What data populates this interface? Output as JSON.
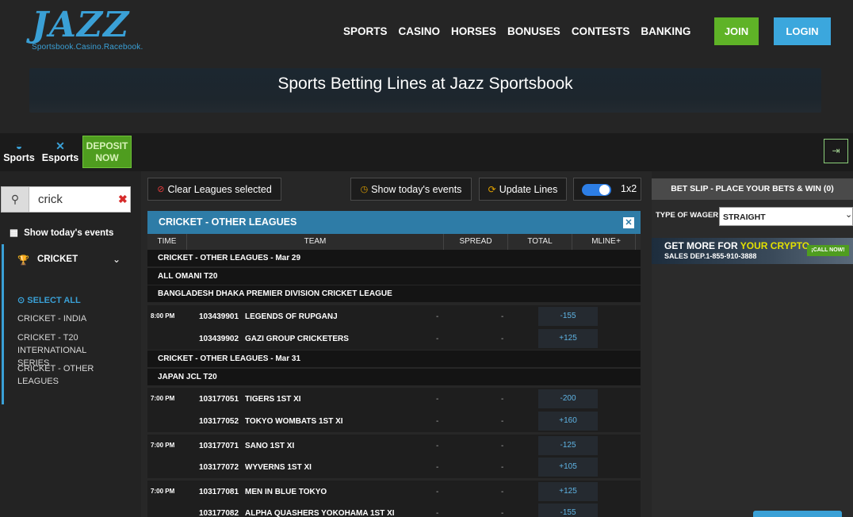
{
  "brand": {
    "logo": "JAZZ",
    "tagline": "Sportsbook.Casino.Racebook."
  },
  "nav": [
    "SPORTS",
    "CASINO",
    "HORSES",
    "BONUSES",
    "CONTESTS",
    "BANKING"
  ],
  "auth": {
    "join": "JOIN",
    "login": "LOGIN"
  },
  "hero_title": "Sports Betting Lines at Jazz Sportsbook",
  "strip": {
    "sports": "Sports",
    "esports": "Esports",
    "deposit": "DEPOSIT NOW"
  },
  "search": {
    "value": "crick",
    "placeholder": ""
  },
  "sidebar": {
    "today": "Show today's events",
    "sport": "CRICKET",
    "select_all": "SELECT ALL",
    "leagues": [
      "CRICKET - INDIA",
      "CRICKET - T20 INTERNATIONAL SERIES",
      "CRICKET - OTHER LEAGUES"
    ]
  },
  "tools": {
    "clear": "Clear Leagues selected",
    "today": "Show today's events",
    "update": "Update Lines",
    "toggle_label": "1x2"
  },
  "panel": {
    "title": "CRICKET - OTHER LEAGUES",
    "columns": [
      "TIME",
      "TEAM",
      "SPREAD",
      "TOTAL",
      "MLINE",
      "+"
    ]
  },
  "groups": [
    "CRICKET - OTHER LEAGUES - Mar 29",
    "ALL OMANI T20",
    "BANGLADESH DHAKA PREMIER DIVISION CRICKET LEAGUE",
    "CRICKET - OTHER LEAGUES - Mar 31",
    "JAPAN JCL T20"
  ],
  "events": [
    {
      "time": "8:00 PM",
      "num": "103439901",
      "team": "LEGENDS OF RUPGANJ",
      "spread": "-",
      "total": "-",
      "mline": "-155"
    },
    {
      "time": "",
      "num": "103439902",
      "team": "GAZI GROUP CRICKETERS",
      "spread": "-",
      "total": "-",
      "mline": "+125"
    },
    {
      "time": "7:00 PM",
      "num": "103177051",
      "team": "TIGERS 1ST XI",
      "spread": "-",
      "total": "-",
      "mline": "-200"
    },
    {
      "time": "",
      "num": "103177052",
      "team": "TOKYO WOMBATS 1ST XI",
      "spread": "-",
      "total": "-",
      "mline": "+160"
    },
    {
      "time": "7:00 PM",
      "num": "103177071",
      "team": "SANO 1ST XI",
      "spread": "-",
      "total": "-",
      "mline": "-125"
    },
    {
      "time": "",
      "num": "103177072",
      "team": "WYVERNS 1ST XI",
      "spread": "-",
      "total": "-",
      "mline": "+105"
    },
    {
      "time": "7:00 PM",
      "num": "103177081",
      "team": "MEN IN BLUE TOKYO",
      "spread": "-",
      "total": "-",
      "mline": "+125"
    },
    {
      "time": "",
      "num": "103177082",
      "team": "ALPHA QUASHERS YOKOHAMA 1ST XI",
      "spread": "-",
      "total": "-",
      "mline": "-155"
    }
  ],
  "betslip": {
    "header": "BET SLIP - PLACE YOUR BETS & WIN (0)",
    "wager_label": "TYPE OF WAGER",
    "wager_value": "STRAIGHT"
  },
  "promo": {
    "line1a": "GET MORE FOR",
    "line1b": "YOUR CRYPTO",
    "line2": "SALES DEP.1-855-910-3888",
    "cta": "¡CALL NOW!"
  },
  "colors": {
    "accent": "#3aa0d6",
    "join": "#5fb327",
    "login": "#3ba7dd",
    "panel": "#2e7ca7"
  }
}
